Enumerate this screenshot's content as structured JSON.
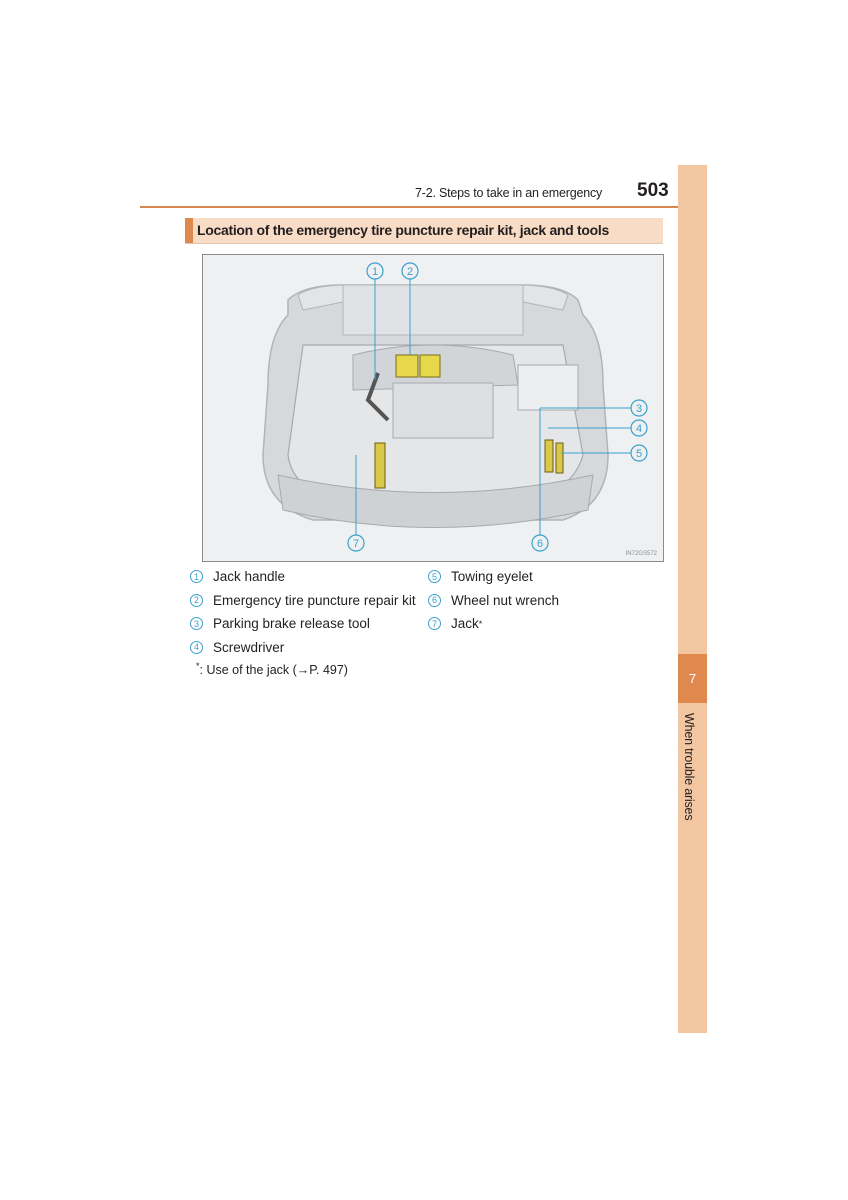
{
  "header": {
    "section_ref": "7-2. Steps to take in an emergency",
    "page_number": "503"
  },
  "side_tab": {
    "chapter_number": "7",
    "chapter_label": "When trouble arises"
  },
  "section": {
    "title": "Location of the emergency tire puncture repair kit, jack and tools"
  },
  "figure": {
    "code": "IN72GS572",
    "callouts": [
      "1",
      "2",
      "3",
      "4",
      "5",
      "6",
      "7"
    ],
    "colors": {
      "callout": "#3ba0d0",
      "highlight": "#e6d84a"
    }
  },
  "legend": {
    "left": [
      {
        "num": "1",
        "label": "Jack handle"
      },
      {
        "num": "2",
        "label": "Emergency tire puncture repair kit"
      },
      {
        "num": "3",
        "label": "Parking brake release tool"
      },
      {
        "num": "4",
        "label": "Screwdriver"
      }
    ],
    "right": [
      {
        "num": "5",
        "label": "Towing eyelet"
      },
      {
        "num": "6",
        "label": "Wheel nut wrench"
      },
      {
        "num": "7",
        "label": "Jack",
        "mark": "*"
      }
    ]
  },
  "footnote": {
    "mark": "*",
    "text": ": Use of the jack (→P. 497)"
  }
}
